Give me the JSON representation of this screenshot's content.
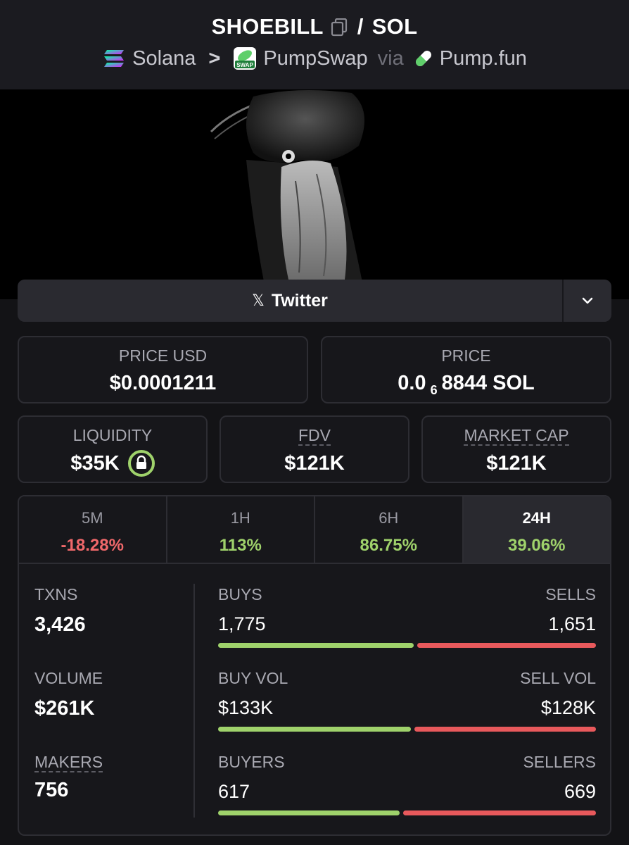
{
  "header": {
    "token": "SHOEBILL",
    "slash": "/",
    "quote": "SOL",
    "chain": "Solana",
    "chevron": ">",
    "dex": "PumpSwap",
    "via": "via",
    "launchpad": "Pump.fun",
    "dex_icon_text": "SWAP"
  },
  "social": {
    "twitter_label": "Twitter",
    "x_glyph": "𝕏"
  },
  "prices": {
    "price_usd_label": "PRICE USD",
    "price_usd_value": "$0.0001211",
    "price_label": "PRICE",
    "price_prefix": "0.0",
    "price_zeros": "6",
    "price_digits": "8844 SOL"
  },
  "metrics": {
    "liquidity_label": "LIQUIDITY",
    "liquidity_value": "$35K",
    "fdv_label": "FDV",
    "fdv_value": "$121K",
    "mcap_label": "MARKET CAP",
    "mcap_value": "$121K"
  },
  "tabs": [
    {
      "label": "5M",
      "value": "-18.28%"
    },
    {
      "label": "1H",
      "value": "113%"
    },
    {
      "label": "6H",
      "value": "86.75%"
    },
    {
      "label": "24H",
      "value": "39.06%"
    }
  ],
  "stats": {
    "txns_label": "TXNS",
    "txns_value": "3,426",
    "volume_label": "VOLUME",
    "volume_value": "$261K",
    "makers_label": "MAKERS",
    "makers_value": "756",
    "buys_label": "BUYS",
    "buys_value": "1,775",
    "sells_label": "SELLS",
    "sells_value": "1,651",
    "buyvol_label": "BUY VOL",
    "buyvol_value": "$133K",
    "sellvol_label": "SELL VOL",
    "sellvol_value": "$128K",
    "buyers_label": "BUYERS",
    "buyers_value": "617",
    "sellers_label": "SELLERS",
    "sellers_value": "669"
  },
  "ratios": {
    "buys_share": 0.518,
    "buyvol_share": 0.51,
    "buyers_share": 0.48
  },
  "colors": {
    "positive": "#9fd26b",
    "negative": "#f0686a",
    "background": "#131316"
  }
}
